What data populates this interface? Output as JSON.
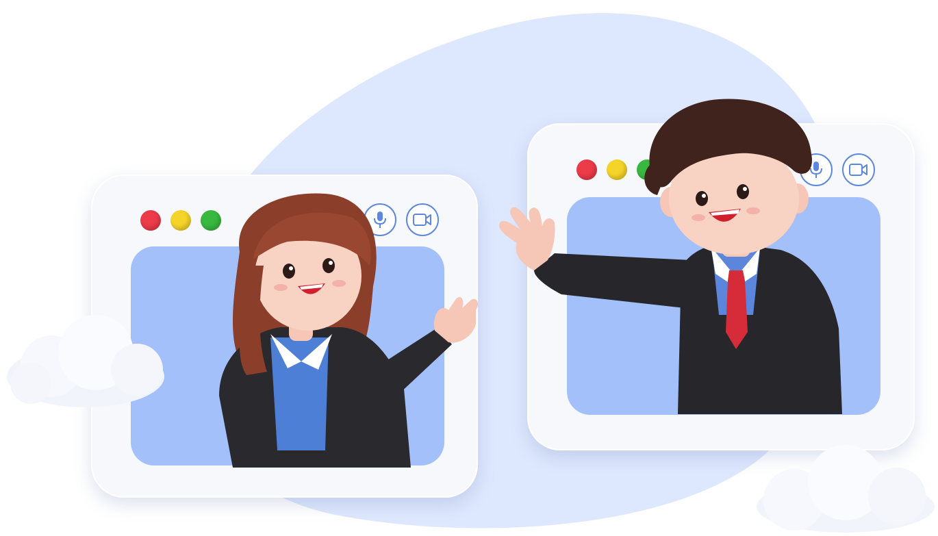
{
  "scene": {
    "windows": [
      {
        "id": "left",
        "controls": [
          "close",
          "minimize",
          "maximize"
        ],
        "buttons": [
          "mic-icon",
          "camera-icon"
        ]
      },
      {
        "id": "right",
        "controls": [
          "close",
          "minimize",
          "maximize"
        ],
        "buttons": [
          "mic-icon",
          "camera-icon"
        ]
      }
    ]
  },
  "colors": {
    "blob": "#dde7fd",
    "screen": "#a3c0fb",
    "window": "#f7f8fb",
    "accent": "#5d86e0",
    "close": "#ec3b49",
    "minimize": "#f5d42a",
    "maximize": "#39b83f"
  }
}
